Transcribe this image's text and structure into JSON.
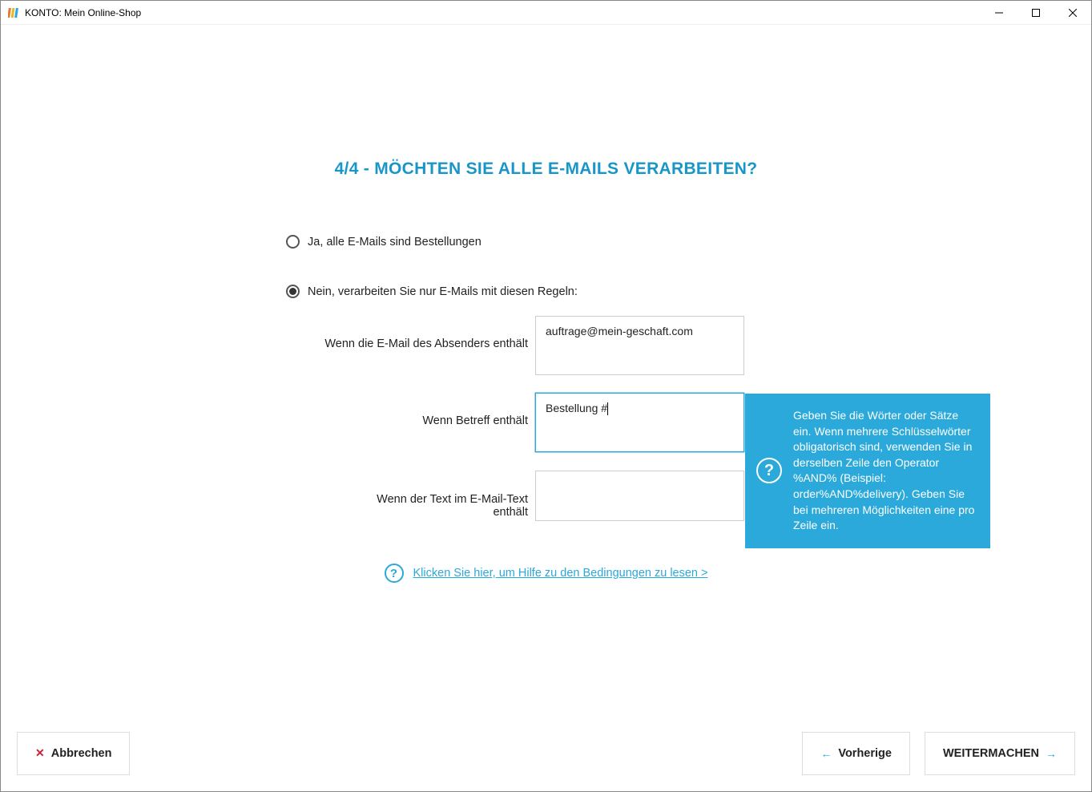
{
  "window": {
    "title": "KONTO: Mein Online-Shop"
  },
  "heading": "4/4 - MÖCHTEN SIE ALLE E-MAILS VERARBEITEN?",
  "radios": {
    "option_yes": "Ja, alle E-Mails sind Bestellungen",
    "option_no": "Nein, verarbeiten Sie nur E-Mails mit diesen Regeln:",
    "selected": "no"
  },
  "fields": {
    "sender": {
      "label": "Wenn die E-Mail des Absenders enthält",
      "value": "auftrage@mein-geschaft.com"
    },
    "subject": {
      "label": "Wenn Betreff enthält",
      "value": "Bestellung #"
    },
    "body": {
      "label": "Wenn der Text im E-Mail-Text enthält",
      "value": ""
    }
  },
  "tooltip": "Geben Sie die Wörter oder Sätze ein. Wenn mehrere Schlüsselwörter obligatorisch sind, verwenden Sie in derselben Zeile den Operator %AND% (Beispiel: order%AND%delivery). Geben Sie bei mehreren Möglichkeiten eine pro Zeile ein.",
  "help_link": "Klicken Sie hier, um Hilfe zu den Bedingungen zu lesen >",
  "buttons": {
    "cancel": "Abbrechen",
    "previous": "Vorherige",
    "continue": "WEITERMACHEN"
  }
}
